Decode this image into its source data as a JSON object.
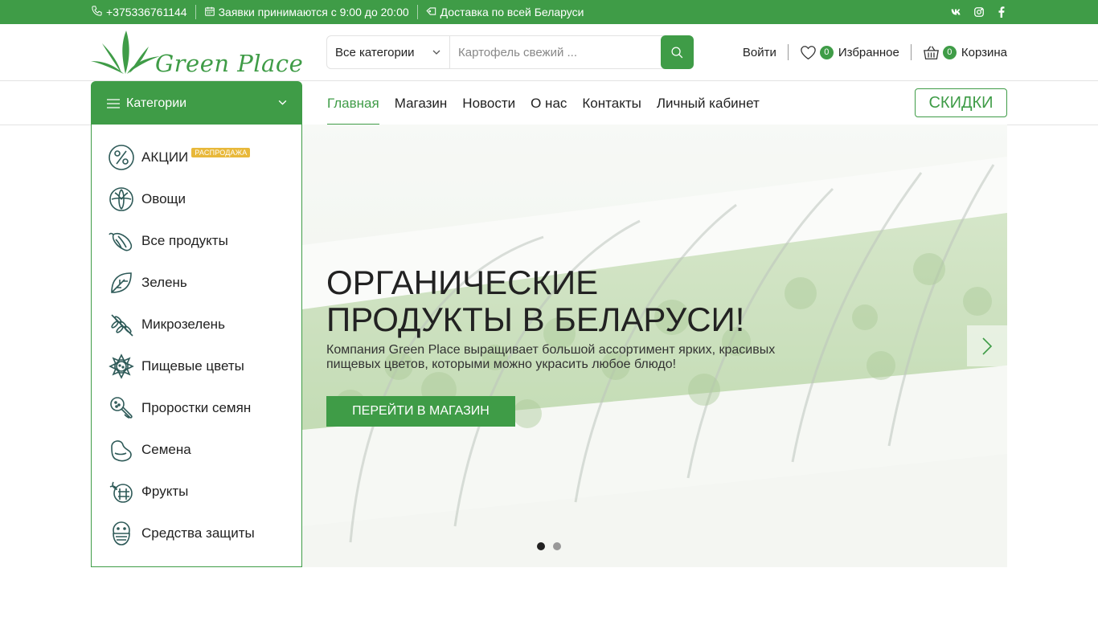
{
  "topbar": {
    "phone": "+375336761144",
    "hours": "Заявки принимаются с 9:00 до 20:00",
    "delivery": "Доставка по всей Беларуси",
    "social": [
      "vk",
      "instagram",
      "facebook"
    ]
  },
  "brand": {
    "name": "Green Place",
    "color": "#3f9c47"
  },
  "search": {
    "category": "Все категории",
    "placeholder": "Картофель свежий ..."
  },
  "header": {
    "login": "Войти",
    "wishlist_count": "0",
    "wishlist_label": "Избранное",
    "cart_count": "0",
    "cart_label": "Корзина"
  },
  "categories_button": "Категории",
  "nav": {
    "items": [
      "Главная",
      "Магазин",
      "Новости",
      "О нас",
      "Контакты",
      "Личный кабинет"
    ],
    "active": "Главная",
    "discount": "СКИДКИ"
  },
  "categories": [
    {
      "label": "АКЦИИ",
      "icon": "percent-icon",
      "tag": "РАСПРОДАЖА"
    },
    {
      "label": "Овощи",
      "icon": "cabbage-icon"
    },
    {
      "label": "Все продукты",
      "icon": "pepper-icon"
    },
    {
      "label": "Зелень",
      "icon": "leaf-icon"
    },
    {
      "label": "Микрозелень",
      "icon": "wheat-icon"
    },
    {
      "label": "Пищевые цветы",
      "icon": "flower-icon"
    },
    {
      "label": "Проростки семян",
      "icon": "sprout-icon"
    },
    {
      "label": "Семена",
      "icon": "seed-icon"
    },
    {
      "label": "Фрукты",
      "icon": "fruit-icon"
    },
    {
      "label": "Средства защиты",
      "icon": "mask-icon"
    }
  ],
  "hero": {
    "title_line1": "ОРГАНИЧЕСКИЕ",
    "title_line2": "ПРОДУКТЫ В БЕЛАРУСИ!",
    "text": "Компания Green Place выращивает большой ассортимент ярких, красивых пищевых цветов, которыми можно украсить любое блюдо!",
    "button": "ПЕРЕЙТИ В МАГАЗИН",
    "slides": 2,
    "active_slide": 1
  }
}
